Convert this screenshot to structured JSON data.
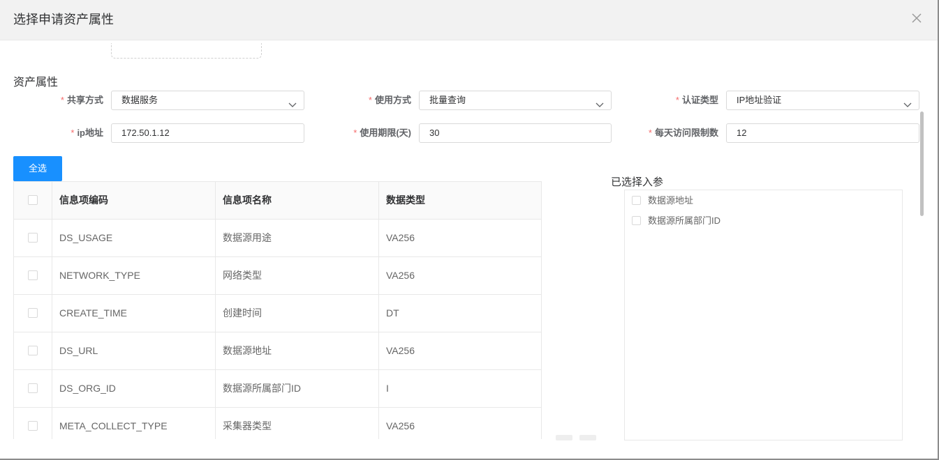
{
  "dialog": {
    "title": "选择申请资产属性",
    "close_icon": "close-icon"
  },
  "section": {
    "title": "资产属性"
  },
  "form": {
    "share_mode": {
      "label": "共享方式",
      "value": "数据服务"
    },
    "usage_mode": {
      "label": "使用方式",
      "value": "批量查询"
    },
    "auth_type": {
      "label": "认证类型",
      "value": "IP地址验证"
    },
    "ip": {
      "label": "ip地址",
      "value": "172.50.1.12"
    },
    "period": {
      "label": "使用期限(天)",
      "value": "30"
    },
    "daily_limit": {
      "label": "每天访问限制数",
      "value": "12"
    },
    "required_mark": "*"
  },
  "buttons": {
    "select_all": "全选"
  },
  "table": {
    "headers": [
      "信息项编码",
      "信息项名称",
      "数据类型"
    ],
    "rows": [
      {
        "code": "DS_USAGE",
        "name": "数据源用途",
        "type": "VA256"
      },
      {
        "code": "NETWORK_TYPE",
        "name": "网络类型",
        "type": "VA256"
      },
      {
        "code": "CREATE_TIME",
        "name": "创建时间",
        "type": "DT"
      },
      {
        "code": "DS_URL",
        "name": "数据源地址",
        "type": "VA256"
      },
      {
        "code": "DS_ORG_ID",
        "name": "数据源所属部门ID",
        "type": "I"
      },
      {
        "code": "META_COLLECT_TYPE",
        "name": "采集器类型",
        "type": "VA256"
      }
    ]
  },
  "selected": {
    "title": "已选择入参",
    "items": [
      "数据源地址",
      "数据源所属部门ID"
    ]
  },
  "colors": {
    "primary": "#1890ff",
    "required": "#f56c6c"
  }
}
